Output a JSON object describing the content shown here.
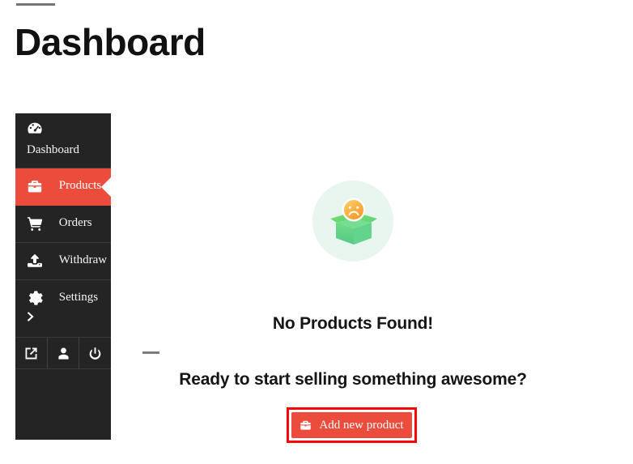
{
  "page": {
    "title": "Dashboard",
    "top_rule": true
  },
  "sidebar": {
    "background_color": "#242424",
    "active_color": "#ec4c3b",
    "items": [
      {
        "label": "Dashboard",
        "icon": "dashboard-gauge-icon",
        "active": false,
        "wrap": true
      },
      {
        "label": "Products",
        "icon": "briefcase-icon",
        "active": true,
        "wrap": false
      },
      {
        "label": "Orders",
        "icon": "shopping-cart-icon",
        "active": false,
        "wrap": false
      },
      {
        "label": "Withdraw",
        "icon": "upload-icon",
        "active": false,
        "wrap": false
      },
      {
        "label": "Settings",
        "icon": "gear-icon",
        "active": false,
        "wrap": false,
        "chevron": "chevron-right-icon"
      }
    ],
    "footer_icons": [
      {
        "name": "external-link-icon"
      },
      {
        "name": "user-icon"
      },
      {
        "name": "power-icon"
      }
    ]
  },
  "main": {
    "illustration": {
      "name": "empty-box-sad-face-illustration",
      "circle_color": "#e8f6ef",
      "box_color": "#5fd68a",
      "box_flap_color": "#65d45f",
      "face_color": "#f7b733"
    },
    "empty_title": "No Products Found!",
    "empty_subtitle": "Ready to start selling something awesome?",
    "cta": {
      "label": "Add new product",
      "icon": "briefcase-icon",
      "background_color": "#ec4c3b",
      "highlight_color": "#fb0606"
    },
    "divider_dash": true
  }
}
